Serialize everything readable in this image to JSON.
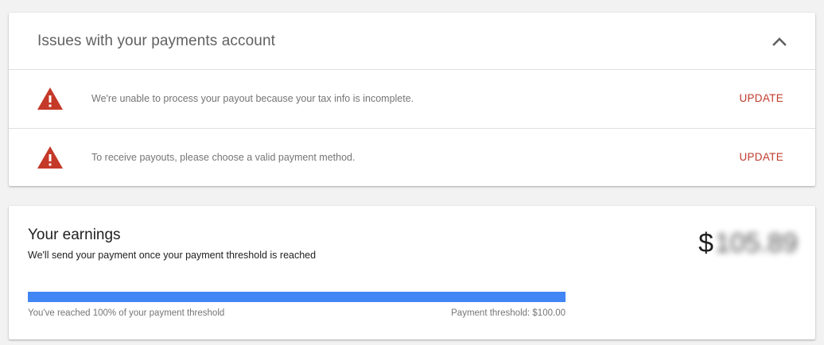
{
  "issues": {
    "title": "Issues with your payments account",
    "items": [
      {
        "text": "We're unable to process your payout because your tax info is incomplete.",
        "action": "UPDATE",
        "icon": "warning-icon"
      },
      {
        "text": "To receive payouts, please choose a valid payment method.",
        "action": "UPDATE",
        "icon": "warning-icon"
      }
    ],
    "collapse_icon": "chevron-up-icon"
  },
  "earnings": {
    "title": "Your earnings",
    "subtitle": "We'll send your payment once your payment threshold is reached",
    "currency_symbol": "$",
    "amount": "105.89",
    "progress_fraction": 1.0,
    "progress_caption": "You've reached 100% of your payment threshold",
    "threshold_caption": "Payment threshold: $100.00"
  },
  "colors": {
    "background": "#f2f2f2",
    "warning": "#c53929",
    "action": "#c0392b",
    "progress": "#4285f4"
  }
}
